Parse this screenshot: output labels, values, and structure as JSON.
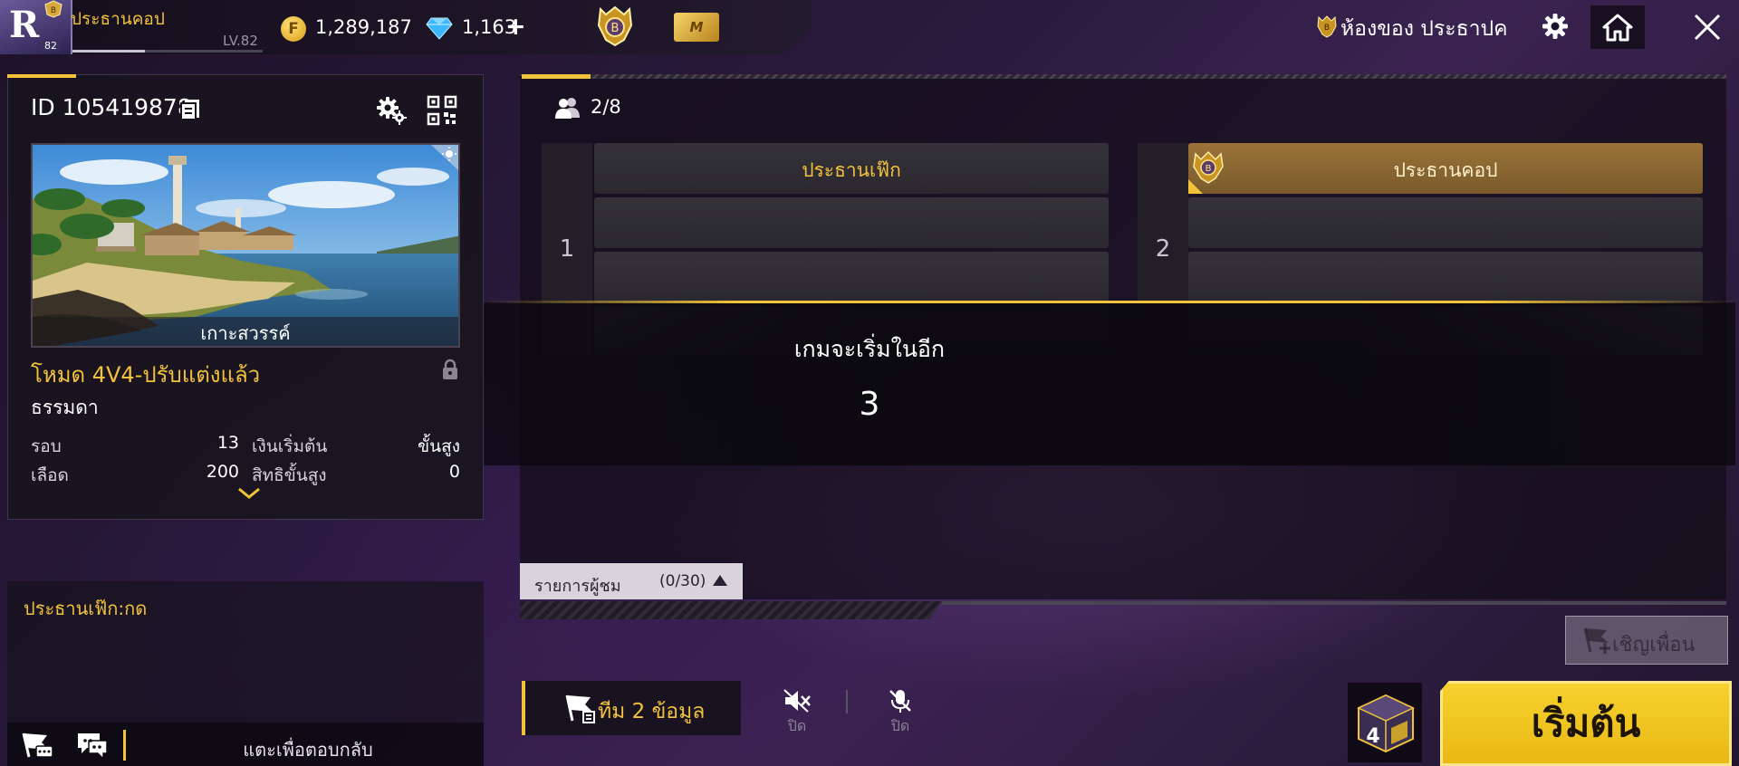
{
  "player": {
    "name": "ประธานคอป",
    "level": "LV.82",
    "avatar_level": "82",
    "avatar_letter": "R",
    "xp_fraction": 0.38
  },
  "currency": {
    "gold": "1,289,187",
    "diamonds": "1,163",
    "plus": "+"
  },
  "top_right": {
    "room_title": "ห้องของ ประธาปค",
    "mvp_label": "M"
  },
  "room": {
    "id": "ID 105419878",
    "map_name": "เกาะสวรรค์",
    "mode_title": "โหมด 4V4-ปรับแต่งแล้ว",
    "mode_subtitle": "ธรรมดา",
    "stats": {
      "rounds_label": "รอบ",
      "rounds_value": "13",
      "money_label": "เงินเริ่มต้น",
      "money_value": "ขั้นสูง",
      "hp_label": "เลือด",
      "hp_value": "200",
      "skill_label": "สิทธิขั้นสูง",
      "skill_value": "0"
    }
  },
  "chat": {
    "message": "ประธานเฟ๊ก:กด",
    "reply_placeholder": "แตะเพื่อตอบกลับ"
  },
  "teams": {
    "players_count": "2/8",
    "team1": {
      "number": "1",
      "slots": [
        "ประธานเฟ๊ก",
        "",
        "",
        ""
      ]
    },
    "team2": {
      "number": "2",
      "slots": [
        "ประธานคอป",
        "",
        "",
        ""
      ]
    }
  },
  "countdown": {
    "label": "เกมจะเริ่มในอีก",
    "value": "3"
  },
  "spectators": {
    "label": "รายการผู้ชม",
    "count": "(0/30)"
  },
  "controls": {
    "invite_label": "เชิญเพื่อน",
    "team_info_label": "ทีม 2 ข้อมูล",
    "speaker_label": "ปิด",
    "mic_label": "ปิด",
    "mode_cube_number": "4",
    "start_label": "เริ่มต้น"
  },
  "colors": {
    "accent": "#f2c23a",
    "start_button": "#f0c41f",
    "own_slot": "#9a7338"
  },
  "icons": {
    "gold": "gold-coin-icon",
    "diamond": "diamond-icon",
    "settings": "gear-icon",
    "home": "home-icon",
    "close": "close-icon",
    "copy": "copy-icon",
    "qr": "qr-code-icon",
    "lock": "lock-icon",
    "players": "players-icon",
    "speaker": "speaker-muted-icon",
    "mic": "mic-muted-icon"
  }
}
